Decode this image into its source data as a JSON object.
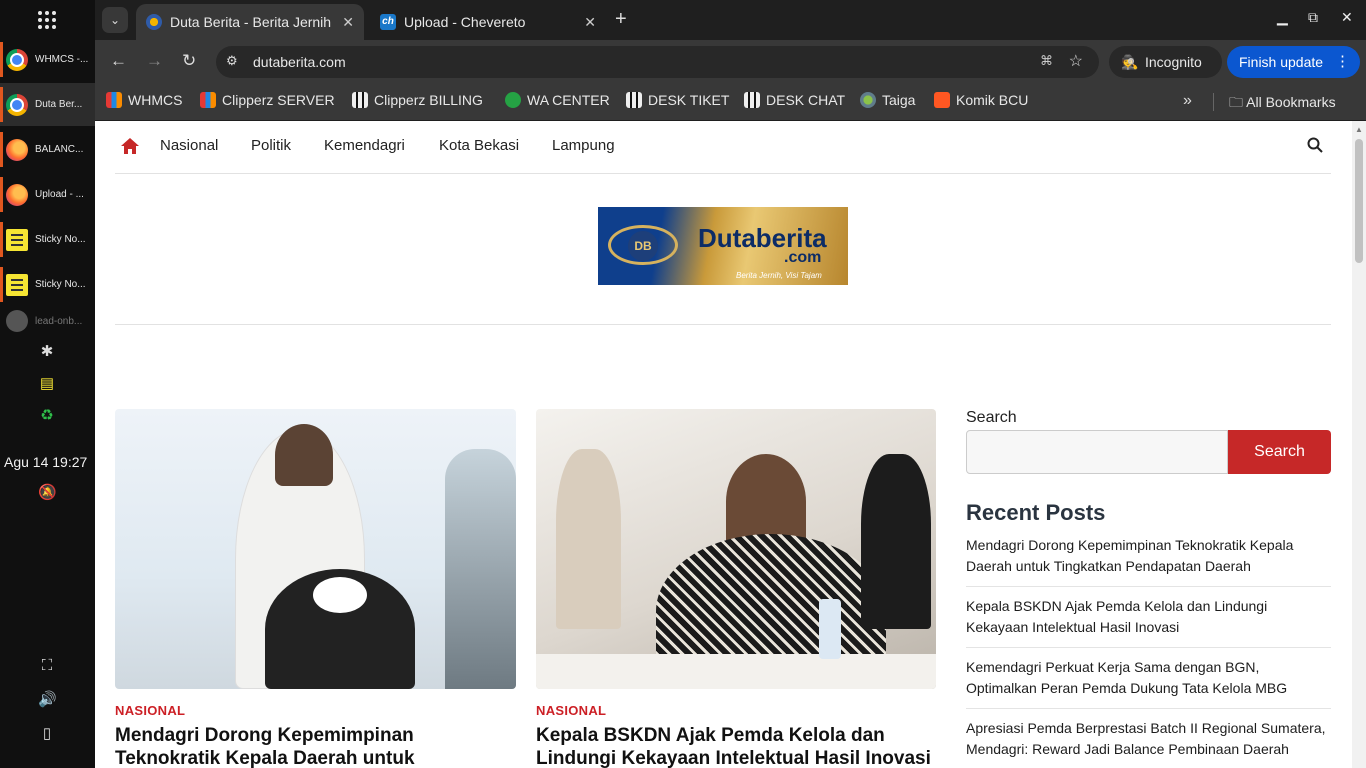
{
  "dock": {
    "items": [
      {
        "label": "WHMCS -...",
        "icon": "chrome-icon"
      },
      {
        "label": "Duta Ber...",
        "icon": "chrome-icon",
        "active": true
      },
      {
        "label": "BALANC...",
        "icon": "firefox-icon"
      },
      {
        "label": "Upload - ...",
        "icon": "firefox-icon"
      },
      {
        "label": "Sticky No...",
        "icon": "sticky-notes-icon"
      },
      {
        "label": "Sticky No...",
        "icon": "sticky-notes-icon"
      },
      {
        "label": "lead-onb...",
        "icon": "app-icon"
      }
    ],
    "clock": "Agu 14  19:27"
  },
  "tabs": [
    {
      "title": "Duta Berita - Berita Jernih",
      "active": true
    },
    {
      "title": "Upload - Chevereto",
      "active": false
    }
  ],
  "toolbar": {
    "url": "dutaberita.com",
    "incognito_label": "Incognito",
    "finish_update_label": "Finish update"
  },
  "bookmarks": [
    {
      "label": "WHMCS"
    },
    {
      "label": "Clipperz SERVER"
    },
    {
      "label": "Clipperz BILLING"
    },
    {
      "label": "WA CENTER"
    },
    {
      "label": "DESK TIKET"
    },
    {
      "label": "DESK CHAT"
    },
    {
      "label": "Taiga"
    },
    {
      "label": "Komik BCU"
    }
  ],
  "all_bookmarks_label": "All Bookmarks",
  "site": {
    "nav": [
      "Nasional",
      "Politik",
      "Kemendagri",
      "Kota Bekasi",
      "Lampung"
    ],
    "logo": {
      "badge": "DB",
      "brand": "Dutaberita",
      "suffix": ".com",
      "tagline": "Berita Jernih, Visi Tajam"
    },
    "articles": [
      {
        "category": "NASIONAL",
        "headline": "Mendagri Dorong Kepemimpinan Teknokratik Kepala Daerah untuk Tingkatkan Pendapatan Daerah"
      },
      {
        "category": "NASIONAL",
        "headline": "Kepala BSKDN Ajak Pemda Kelola dan Lindungi Kekayaan Intelektual Hasil Inovasi"
      }
    ],
    "sidebar": {
      "search_label": "Search",
      "search_button": "Search",
      "recent_title": "Recent Posts",
      "recent_posts": [
        "Mendagri Dorong Kepemimpinan Teknokratik Kepala Daerah untuk Tingkatkan Pendapatan Daerah",
        "Kepala BSKDN Ajak Pemda Kelola dan Lindungi Kekayaan Intelektual Hasil Inovasi",
        "Kemendagri Perkuat Kerja Sama dengan BGN, Optimalkan Peran Pemda Dukung Tata Kelola MBG",
        "Apresiasi Pemda Berprestasi Batch II Regional Sumatera, Mendagri: Reward Jadi Balance Pembinaan Daerah"
      ]
    }
  },
  "colors": {
    "accent_red": "#c62828",
    "brand_blue": "#0c2c66",
    "brand_gold": "#e9c873",
    "update_blue": "#0b57d0"
  }
}
